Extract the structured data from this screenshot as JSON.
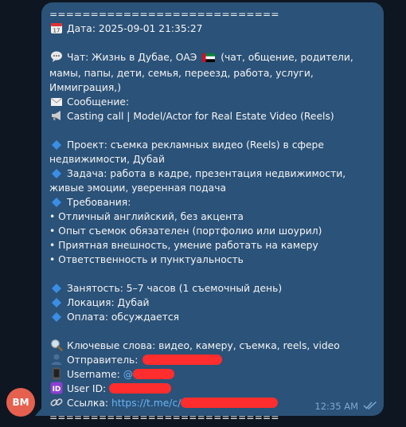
{
  "sender": {
    "avatar_initials": "BM",
    "avatar_color": "#e5604e"
  },
  "message": {
    "separator_top": "============================",
    "date_label": "Дата: 2025-09-01 21:35:27",
    "chat_label": "Чат: Жизнь в Дубае, ОАЭ",
    "chat_tags": "(чат, общение, родители, мамы, папы, дети, семья, переезд, работа, услуги, Иммиграция,)",
    "message_label": "Сообщение:",
    "title": "Casting call | Model/Actor for Real Estate Video (Reels)",
    "project": "Проект: съемка рекламных видео (Reels) в сфере недвижимости, Дубай",
    "task": "Задача: работа в кадре, презентация недвижимости, живые эмоции, уверенная подача",
    "requirements_label": "Требования:",
    "requirements": [
      "• Отличный английский, без акцента",
      "• Опыт съемок обязателен (портфолио или шоурил)",
      "• Приятная внешность, умение работать на камеру",
      "• Ответственность и пунктуальность"
    ],
    "employment": "Занятость: 5–7 часов (1 съемочный день)",
    "location": "Локация: Дубай",
    "payment": "Оплата: обсуждается",
    "keywords": "Ключевые слова: видео, камеру, съемка, reels, video",
    "sender_label": "Отправитель:",
    "username_label": "Username:",
    "username_prefix": "@",
    "userid_label": "User ID:",
    "link_label": "Ссылка:",
    "link_prefix": "https://t.me/c/",
    "separator_bottom": "============================",
    "time": "12:35 AM"
  },
  "icons": {
    "calendar": "calendar-icon",
    "chat": "speech-bubble-icon",
    "flag": "uae-flag-icon",
    "envelope": "envelope-icon",
    "megaphone": "megaphone-icon",
    "diamond": "blue-diamond-icon",
    "magnifier": "magnifier-icon",
    "person": "person-silhouette-icon",
    "phone": "mobile-phone-icon",
    "id": "id-badge-icon",
    "link": "link-icon",
    "read_status": "double-check-icon"
  },
  "colors": {
    "bubble": "#2b5278",
    "background": "#0e1621",
    "link": "#6ab3f3",
    "redaction": "#ff2d2d"
  }
}
